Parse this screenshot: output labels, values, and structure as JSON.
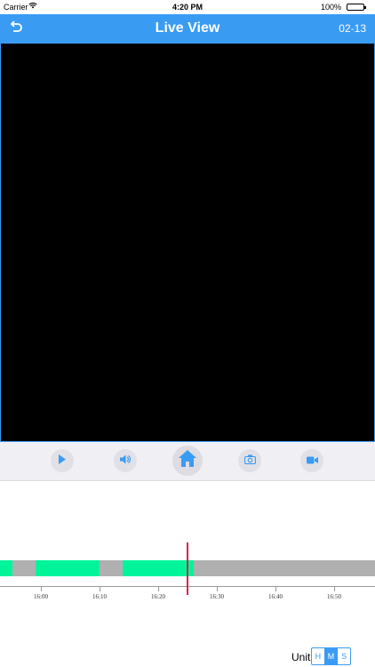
{
  "status_bar": {
    "carrier": "Carrier",
    "time": "4:20 PM",
    "battery": "100%"
  },
  "nav": {
    "title": "Live View",
    "date": "02-13"
  },
  "controls": {
    "items": [
      {
        "name": "play-button",
        "icon": "play-icon"
      },
      {
        "name": "volume-button",
        "icon": "speaker-icon"
      },
      {
        "name": "home-button",
        "icon": "home-icon"
      },
      {
        "name": "snapshot-button",
        "icon": "camera-icon"
      },
      {
        "name": "record-button",
        "icon": "video-camera-icon"
      }
    ]
  },
  "timeline": {
    "tick_labels": [
      "16:00",
      "16:10",
      "16:20",
      "16:30",
      "16:40",
      "16:50"
    ],
    "current_time": "16:25",
    "colors": {
      "recorded": "#00f59a",
      "empty": "#b0b0b0",
      "cursor": "#e0224a"
    }
  },
  "unit": {
    "label": "Unit",
    "options": [
      "H",
      "M",
      "S"
    ],
    "selected": "M"
  },
  "colors": {
    "accent": "#3a9bf3",
    "toolbar_bg": "#efeff4",
    "video_bg": "#000000"
  }
}
